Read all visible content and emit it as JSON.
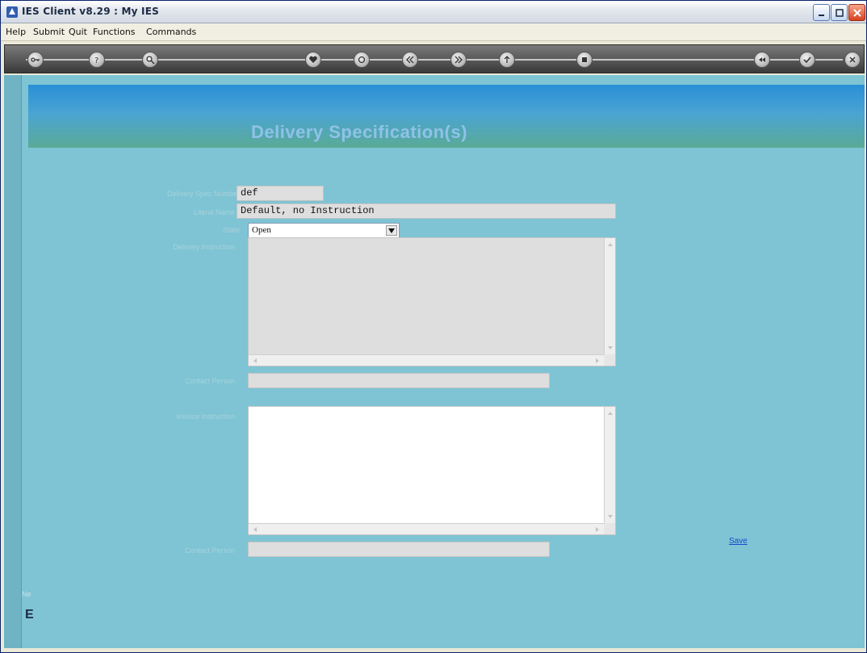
{
  "window": {
    "title": "IES Client v8.29 : My IES"
  },
  "menubar": {
    "items": [
      "Help",
      "Submit",
      "Quit",
      "Functions",
      "Commands"
    ]
  },
  "toolbar": {
    "icons": [
      "key-icon",
      "help-icon",
      "search-icon",
      "heart-icon",
      "refresh-icon",
      "prev-icon",
      "next-icon",
      "up-icon",
      "stop-icon",
      "rewind-icon",
      "check-icon",
      "close-icon"
    ]
  },
  "page": {
    "title": "Delivery Specification(s)"
  },
  "form": {
    "spec_number": {
      "label": "Delivery Spec Number",
      "value": "def"
    },
    "long_name": {
      "label": "Literal Name",
      "value": "Default, no Instruction"
    },
    "state": {
      "label": "State",
      "value": "Open"
    },
    "delivery_instruction": {
      "label": "Delivery Instruction",
      "value": ""
    },
    "contact_person_1": {
      "label": "Contact Person",
      "value": ""
    },
    "invoice_instruction": {
      "label": "Invoice Instruction",
      "value": ""
    },
    "contact_person_2": {
      "label": "Contact Person",
      "value": ""
    },
    "save_label": "Save"
  },
  "status": {
    "fragment": "Ne",
    "fragment2": "E"
  }
}
